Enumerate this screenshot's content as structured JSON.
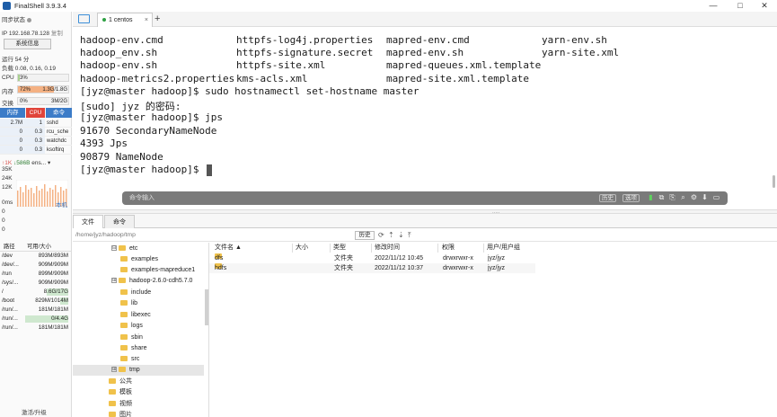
{
  "app": {
    "title": "FinalShell 3.9.3.4"
  },
  "window_controls": {
    "minimize": "—",
    "maximize": "□",
    "close": "✕"
  },
  "left": {
    "sync_status": "同步状态",
    "ip": "IP 192.168.78.128",
    "copy": "复制",
    "sysinfo_button": "系统信息",
    "uptime": "运行 54 分",
    "load": "负载 0.08, 0.16, 0.19",
    "cpu_label": "CPU",
    "cpu_value": "3%",
    "cpu_percent": 3,
    "mem_label": "内存",
    "mem_percent_text": "72%",
    "mem_value": "1.3G/1.8G",
    "mem_percent": 72,
    "swap_label": "交换",
    "swap_percent_text": "0%",
    "swap_value": "3M/2G",
    "proc_tabs": {
      "mem": "内存",
      "cpu": "CPU",
      "cmd": "命令"
    },
    "processes": [
      {
        "mem": "2.7M",
        "cpu": "1",
        "cmd": "sshd"
      },
      {
        "mem": "0",
        "cpu": "0.3",
        "cmd": "rcu_sche"
      },
      {
        "mem": "0",
        "cpu": "0.3",
        "cmd": "watchdc"
      },
      {
        "mem": "0",
        "cpu": "0.3",
        "cmd": "ksoftirq"
      }
    ],
    "net": {
      "up": "↑1K",
      "down": "↓586B",
      "iface": "ens..."
    },
    "net_scale": [
      "35K",
      "24K",
      "12K"
    ],
    "ping": {
      "value": "0ms",
      "host": "本机"
    },
    "ping_scale": [
      "0",
      "0",
      "0"
    ],
    "disk_headers": {
      "path": "路径",
      "size": "可用/大小"
    },
    "disks": [
      {
        "path": "/dev",
        "size": "893M/893M",
        "used": 0
      },
      {
        "path": "/dev/...",
        "size": "909M/909M",
        "used": 0
      },
      {
        "path": "/run",
        "size": "899M/909M",
        "used": 1
      },
      {
        "path": "/sys/...",
        "size": "909M/909M",
        "used": 0
      },
      {
        "path": "/",
        "size": "8.6G/17G",
        "used": 49
      },
      {
        "path": "/boot",
        "size": "829M/1014M",
        "used": 18
      },
      {
        "path": "/run/...",
        "size": "181M/181M",
        "used": 0
      },
      {
        "path": "/run/...",
        "size": "0/4.4G",
        "used": 100
      },
      {
        "path": "/run/...",
        "size": "181M/181M",
        "used": 0
      }
    ],
    "upgrade": "激活/升级"
  },
  "tabs": {
    "session": "1 centos",
    "close": "×",
    "add": "+"
  },
  "terminal": {
    "ls": [
      [
        "hadoop-env.cmd",
        "httpfs-log4j.properties",
        "mapred-env.cmd",
        "yarn-env.sh"
      ],
      [
        "hadoop_env.sh",
        "httpfs-signature.secret",
        "mapred-env.sh",
        "yarn-site.xml"
      ],
      [
        "hadoop-env.sh",
        "httpfs-site.xml",
        "mapred-queues.xml.template",
        ""
      ],
      [
        "hadoop-metrics2.properties",
        "kms-acls.xml",
        "mapred-site.xml.template",
        ""
      ]
    ],
    "lines": [
      "[jyz@master hadoop]$ sudo hostnamectl set-hostname master",
      "[sudo] jyz 的密码:",
      "[jyz@master hadoop]$ jps",
      "91670 SecondaryNameNode",
      "4393 Jps",
      "90879 NameNode",
      "[jyz@master hadoop]$ "
    ]
  },
  "cmdbar": {
    "placeholder": "命令输入",
    "history": "历史",
    "options": "选项"
  },
  "filepanel": {
    "tabs": {
      "files": "文件",
      "commands": "命令"
    },
    "path": "/home/jyz/hadoop/tmp",
    "history_button": "历史",
    "tree": [
      {
        "name": "etc",
        "expander": "⊟"
      },
      {
        "name": "examples",
        "expander": ""
      },
      {
        "name": "examples-mapreduce1",
        "expander": ""
      },
      {
        "name": "hadoop-2.6.0-cdh5.7.0",
        "expander": "⊞"
      },
      {
        "name": "include",
        "expander": ""
      },
      {
        "name": "lib",
        "expander": ""
      },
      {
        "name": "libexec",
        "expander": ""
      },
      {
        "name": "logs",
        "expander": ""
      },
      {
        "name": "sbin",
        "expander": ""
      },
      {
        "name": "share",
        "expander": ""
      },
      {
        "name": "src",
        "expander": ""
      },
      {
        "name": "tmp",
        "expander": "⊞"
      },
      {
        "name": "公共",
        "expander": ""
      },
      {
        "name": "模板",
        "expander": ""
      },
      {
        "name": "视频",
        "expander": ""
      },
      {
        "name": "图片",
        "expander": ""
      }
    ],
    "columns": {
      "name": "文件名 ▲",
      "size": "大小",
      "type": "类型",
      "mtime": "修改时间",
      "perm": "权限",
      "owner": "用户/用户组"
    },
    "files": [
      {
        "name": "dfs",
        "size": "",
        "type": "文件夹",
        "mtime": "2022/11/12 10:45",
        "perm": "drwxrwxr-x",
        "owner": "jyz/jyz"
      },
      {
        "name": "hdfs",
        "size": "",
        "type": "文件夹",
        "mtime": "2022/11/12 10:37",
        "perm": "drwxrwxr-x",
        "owner": "jyz/jyz"
      }
    ]
  },
  "colors": {
    "accent": "#1e5ea8",
    "mem_fill": "#f4b183",
    "cpu_tab": "#e0443a",
    "mem_tab": "#3c7cc8",
    "folder": "#f0c24b"
  }
}
